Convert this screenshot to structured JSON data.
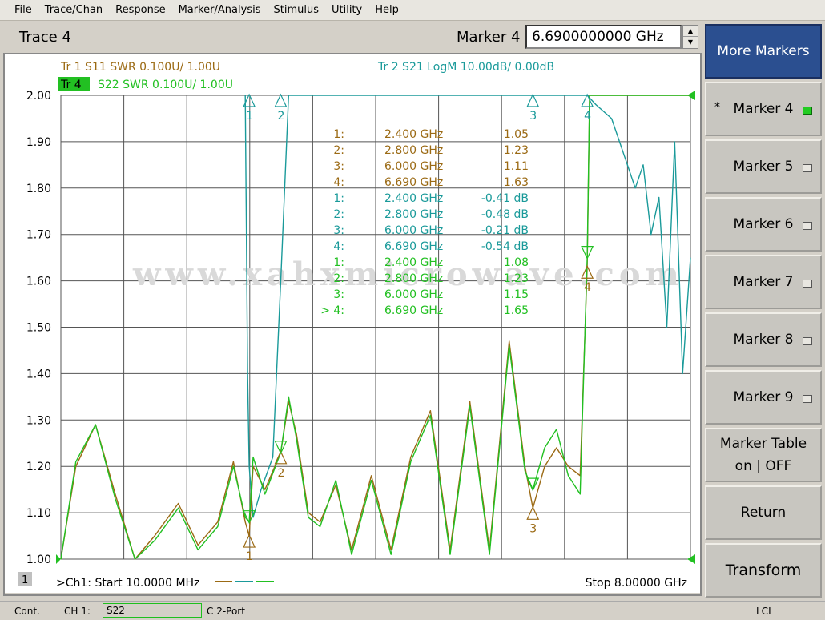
{
  "menu": [
    "File",
    "Trace/Chan",
    "Response",
    "Marker/Analysis",
    "Stimulus",
    "Utility",
    "Help"
  ],
  "header": {
    "trace_title": "Trace 4",
    "marker_label": "Marker 4",
    "marker_value": "6.6900000000 GHz"
  },
  "colors": {
    "tr1": "#9b6a14",
    "tr2": "#1a9a9a",
    "tr4": "#22c022",
    "grid": "#555555",
    "active_key": "#2b4f90"
  },
  "plot": {
    "trace_labels": {
      "tr1": "Tr  1   S11  SWR  0.100U/   1.00U",
      "tr4_tag": "Tr  4",
      "tr4": "S22  SWR  0.100U/   1.00U",
      "tr2": "Tr  2    S21  LogM  10.00dB/   0.00dB"
    },
    "watermark": "www.xahxmicrowave.com",
    "channel_no": "1",
    "start_label": ">Ch1:  Start   10.0000 MHz",
    "stop_label": "Stop   8.00000 GHz",
    "ytick_labels": [
      "2.00",
      "1.90",
      "1.80",
      "1.70",
      "1.60",
      "1.50",
      "1.40",
      "1.30",
      "1.20",
      "1.10",
      "1.00"
    ],
    "marker_numbers": {
      "top": [
        "1",
        "2",
        "3",
        "4"
      ],
      "bottom": [
        "1",
        "2",
        "3",
        "4"
      ]
    },
    "marker_table": [
      {
        "idx": "1:",
        "freq": "2.400 GHz",
        "val": "1.05",
        "trace": "tr1"
      },
      {
        "idx": "2:",
        "freq": "2.800 GHz",
        "val": "1.23",
        "trace": "tr1"
      },
      {
        "idx": "3:",
        "freq": "6.000 GHz",
        "val": "1.11",
        "trace": "tr1"
      },
      {
        "idx": "4:",
        "freq": "6.690 GHz",
        "val": "1.63",
        "trace": "tr1"
      },
      {
        "idx": "1:",
        "freq": "2.400 GHz",
        "val": "-0.41 dB",
        "trace": "tr2"
      },
      {
        "idx": "2:",
        "freq": "2.800 GHz",
        "val": "-0.48 dB",
        "trace": "tr2"
      },
      {
        "idx": "3:",
        "freq": "6.000 GHz",
        "val": "-0.21 dB",
        "trace": "tr2"
      },
      {
        "idx": "4:",
        "freq": "6.690 GHz",
        "val": "-0.54 dB",
        "trace": "tr2"
      },
      {
        "idx": "1:",
        "freq": "2.400 GHz",
        "val": "1.08",
        "trace": "tr4"
      },
      {
        "idx": "2:",
        "freq": "2.800 GHz",
        "val": "1.23",
        "trace": "tr4"
      },
      {
        "idx": "3:",
        "freq": "6.000 GHz",
        "val": "1.15",
        "trace": "tr4"
      },
      {
        "idx": "> 4:",
        "freq": "6.690 GHz",
        "val": "1.65",
        "trace": "tr4"
      }
    ]
  },
  "chart_data": {
    "type": "line",
    "x_unit": "GHz",
    "xlim": [
      0.01,
      8.0
    ],
    "ylim": [
      1.0,
      2.0
    ],
    "yticks": [
      1.0,
      1.1,
      1.2,
      1.3,
      1.4,
      1.5,
      1.6,
      1.7,
      1.8,
      1.9,
      2.0
    ],
    "grid": true,
    "series": [
      {
        "name": "Tr 1 S11 SWR",
        "key": "tr1",
        "x": [
          0.01,
          0.2,
          0.45,
          0.7,
          0.95,
          1.2,
          1.5,
          1.75,
          2.0,
          2.2,
          2.35,
          2.4,
          2.45,
          2.6,
          2.8,
          2.9,
          3.0,
          3.15,
          3.3,
          3.5,
          3.7,
          3.95,
          4.2,
          4.45,
          4.7,
          4.95,
          5.2,
          5.45,
          5.7,
          5.9,
          6.0,
          6.15,
          6.3,
          6.45,
          6.6,
          6.69,
          6.72,
          6.9,
          7.2,
          7.5,
          7.8,
          8.0
        ],
        "y": [
          1.0,
          1.2,
          1.29,
          1.14,
          1.0,
          1.05,
          1.12,
          1.03,
          1.08,
          1.21,
          1.08,
          1.05,
          1.2,
          1.15,
          1.23,
          1.34,
          1.27,
          1.1,
          1.08,
          1.16,
          1.02,
          1.18,
          1.02,
          1.22,
          1.32,
          1.02,
          1.34,
          1.02,
          1.47,
          1.2,
          1.11,
          1.2,
          1.24,
          1.2,
          1.18,
          1.63,
          2.0,
          2.0,
          2.0,
          2.0,
          2.0,
          2.0
        ]
      },
      {
        "name": "Tr 2 S21 LogM",
        "key": "tr2",
        "x": [
          2.35,
          2.38,
          2.4,
          2.45,
          2.55,
          2.7,
          2.8,
          2.9,
          3.5,
          4.5,
          5.5,
          6.0,
          6.5,
          6.69,
          6.8,
          7.0,
          7.2,
          7.3,
          7.4,
          7.5,
          7.6,
          7.7,
          7.8,
          7.9,
          8.0
        ],
        "y": [
          2.0,
          1.4,
          1.2,
          1.09,
          1.15,
          1.22,
          1.6,
          2.0,
          2.0,
          2.0,
          2.0,
          2.0,
          2.0,
          2.0,
          1.98,
          1.95,
          1.85,
          1.8,
          1.85,
          1.7,
          1.78,
          1.5,
          1.9,
          1.4,
          1.65
        ]
      },
      {
        "name": "Tr 4 S22 SWR",
        "key": "tr4",
        "x": [
          0.01,
          0.2,
          0.45,
          0.7,
          0.95,
          1.2,
          1.5,
          1.75,
          2.0,
          2.2,
          2.35,
          2.4,
          2.45,
          2.6,
          2.8,
          2.9,
          3.0,
          3.15,
          3.3,
          3.5,
          3.7,
          3.95,
          4.2,
          4.45,
          4.7,
          4.95,
          5.2,
          5.45,
          5.7,
          5.9,
          6.0,
          6.15,
          6.3,
          6.45,
          6.6,
          6.69,
          6.72,
          6.9,
          7.2,
          7.5,
          7.8,
          8.0
        ],
        "y": [
          1.0,
          1.21,
          1.29,
          1.13,
          1.0,
          1.04,
          1.11,
          1.02,
          1.07,
          1.2,
          1.09,
          1.08,
          1.22,
          1.14,
          1.23,
          1.35,
          1.26,
          1.09,
          1.07,
          1.17,
          1.01,
          1.17,
          1.01,
          1.21,
          1.31,
          1.01,
          1.33,
          1.01,
          1.46,
          1.19,
          1.15,
          1.24,
          1.28,
          1.18,
          1.14,
          1.65,
          2.0,
          2.0,
          2.0,
          2.0,
          2.0,
          2.0
        ]
      }
    ],
    "markers": [
      {
        "n": 1,
        "x": 2.4
      },
      {
        "n": 2,
        "x": 2.8
      },
      {
        "n": 3,
        "x": 6.0
      },
      {
        "n": 4,
        "x": 6.69
      }
    ]
  },
  "softkeys": [
    {
      "label": "More Markers",
      "active": true,
      "type": "plain"
    },
    {
      "label": "Marker 4",
      "active": false,
      "type": "marker",
      "star": "*",
      "on": true
    },
    {
      "label": "Marker 5",
      "active": false,
      "type": "marker",
      "star": "",
      "on": false
    },
    {
      "label": "Marker 6",
      "active": false,
      "type": "marker",
      "star": "",
      "on": false
    },
    {
      "label": "Marker 7",
      "active": false,
      "type": "marker",
      "star": "",
      "on": false
    },
    {
      "label": "Marker 8",
      "active": false,
      "type": "marker",
      "star": "",
      "on": false
    },
    {
      "label": "Marker 9",
      "active": false,
      "type": "marker",
      "star": "",
      "on": false
    },
    {
      "label": "Marker Table",
      "label2": "on  |  OFF",
      "active": false,
      "type": "two-line"
    },
    {
      "label": "Return",
      "active": false,
      "type": "plain"
    },
    {
      "label": "Transform",
      "active": false,
      "type": "plain"
    }
  ],
  "status": {
    "cont": "Cont.",
    "ch": "CH 1:",
    "param": "S22",
    "port": "C  2-Port",
    "lcl": "LCL"
  }
}
